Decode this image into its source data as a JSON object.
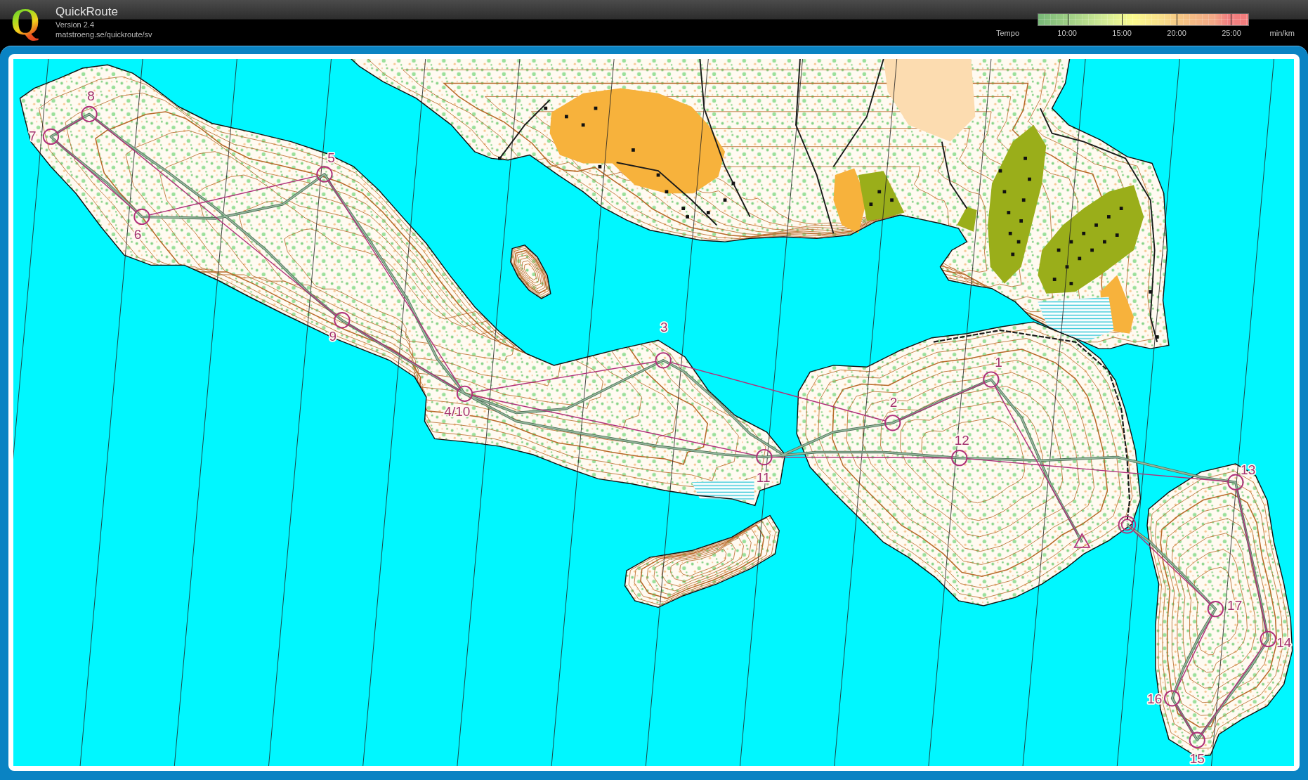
{
  "app": {
    "logo": "Q",
    "title": "QuickRoute",
    "version": "Version 2.4",
    "url": "matstroeng.se/quickroute/sv"
  },
  "tempo_legend": {
    "label": "Tempo",
    "ticks": [
      "10:00",
      "15:00",
      "20:00",
      "25:00"
    ],
    "unit": "min/km"
  },
  "map": {
    "controls": [
      {
        "kind": "start"
      },
      {
        "kind": "control",
        "label": "1"
      },
      {
        "kind": "control",
        "label": "2"
      },
      {
        "kind": "control",
        "label": "3"
      },
      {
        "kind": "control",
        "label": "4/10"
      },
      {
        "kind": "control",
        "label": "5"
      },
      {
        "kind": "control",
        "label": "6"
      },
      {
        "kind": "control",
        "label": "7"
      },
      {
        "kind": "control",
        "label": "8"
      },
      {
        "kind": "control",
        "label": "9"
      },
      {
        "kind": "control",
        "label": "11"
      },
      {
        "kind": "control",
        "label": "12"
      },
      {
        "kind": "control",
        "label": "13"
      },
      {
        "kind": "control",
        "label": "14"
      },
      {
        "kind": "control",
        "label": "15"
      },
      {
        "kind": "control",
        "label": "16"
      },
      {
        "kind": "control",
        "label": "17"
      },
      {
        "kind": "finish"
      }
    ]
  }
}
